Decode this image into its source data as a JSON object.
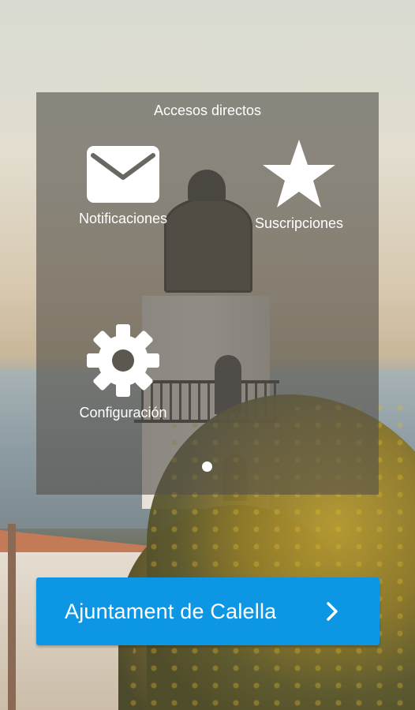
{
  "shortcuts": {
    "title": "Accesos directos",
    "items": [
      {
        "label": "Notificaciones",
        "icon": "envelope-icon"
      },
      {
        "label": "Suscripciones",
        "icon": "star-icon"
      },
      {
        "label": "Configuración",
        "icon": "gear-icon"
      }
    ],
    "page_count": 1,
    "current_page": 1
  },
  "cta": {
    "label": "Ajuntament de Calella",
    "icon": "chevron-right-icon",
    "color": "#0c96e4"
  }
}
